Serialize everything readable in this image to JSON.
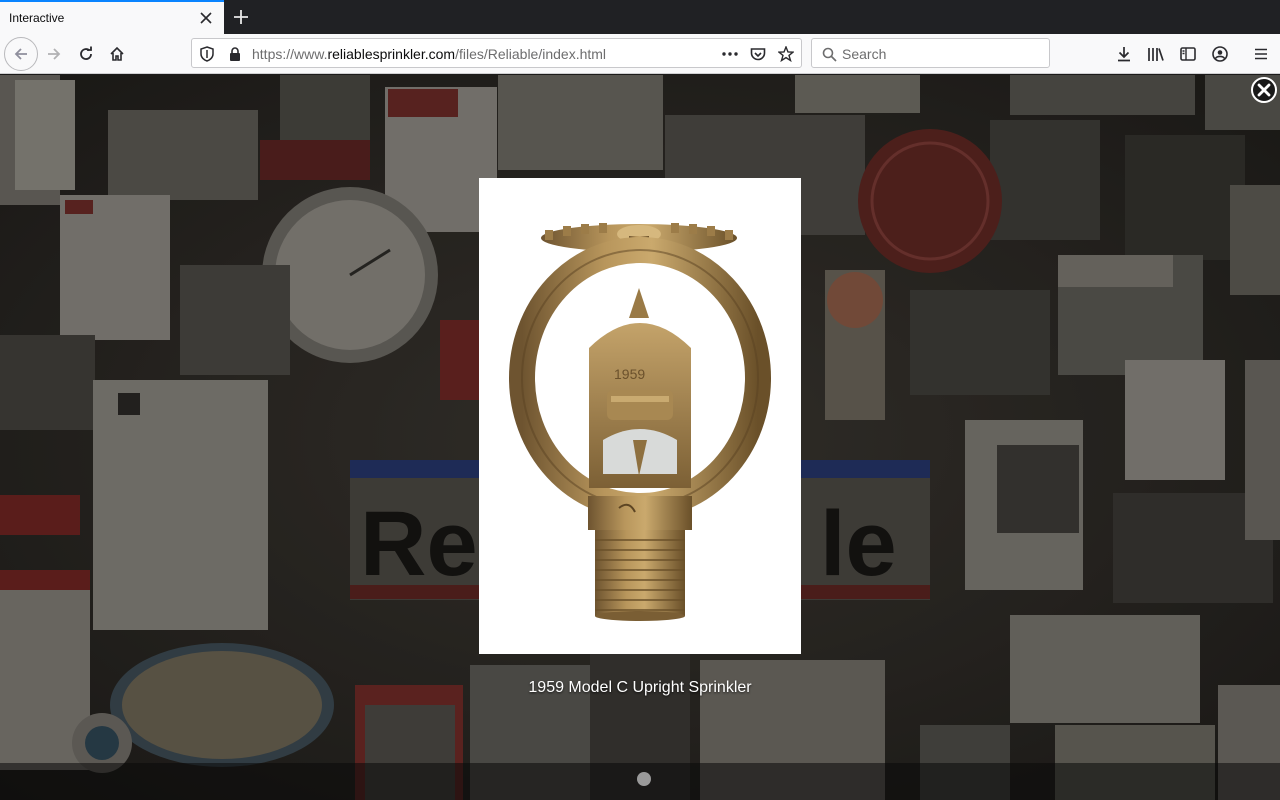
{
  "browser": {
    "tab_title": "Interactive",
    "url_prefix": "https://www.",
    "url_domain": "reliablesprinkler.com",
    "url_path": "/files/Reliable/index.html",
    "search_placeholder": "Search"
  },
  "gallery": {
    "caption": "1959 Model C Upright Sprinkler",
    "image_name": "sprinkler-photo",
    "stamp_text": "1959"
  },
  "colors": {
    "accent": "#0a84ff",
    "brass": "#a8864f"
  }
}
